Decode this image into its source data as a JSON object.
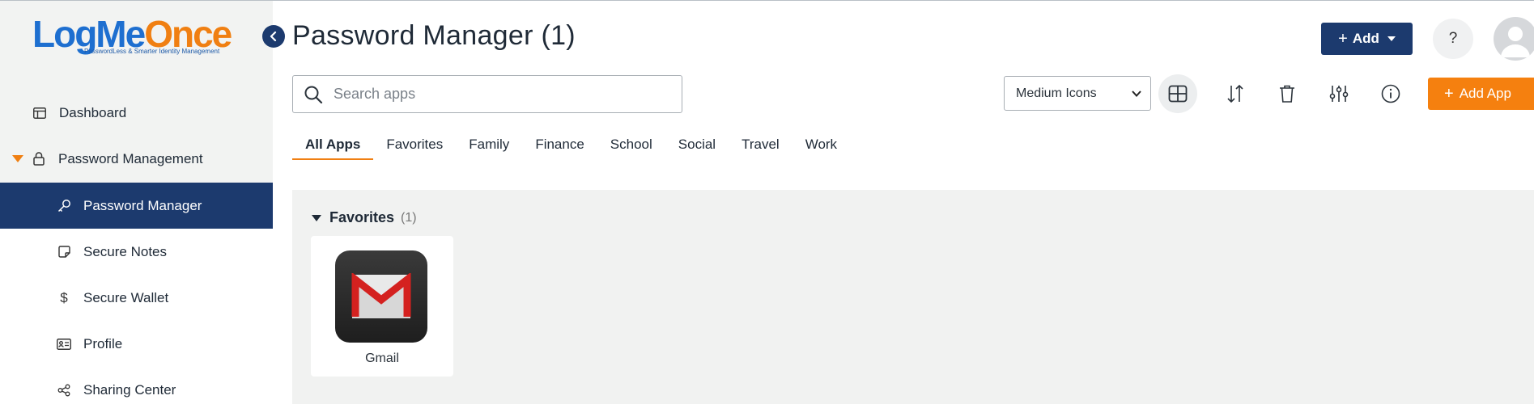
{
  "brand": {
    "logo_part1": "LogMe",
    "logo_part2": "Once",
    "tagline": "PasswordLess & Smarter Identity Management"
  },
  "sidebar": {
    "items": [
      {
        "label": "Dashboard",
        "icon": "dashboard-icon"
      },
      {
        "label": "Password Management",
        "icon": "lock-icon",
        "expanded": true
      },
      {
        "label": "Password Manager",
        "icon": "key-icon",
        "active": true
      },
      {
        "label": "Secure Notes",
        "icon": "note-icon"
      },
      {
        "label": "Secure Wallet",
        "icon": "dollar-icon"
      },
      {
        "label": "Profile",
        "icon": "id-card-icon"
      },
      {
        "label": "Sharing Center",
        "icon": "share-icon"
      }
    ]
  },
  "header": {
    "title": "Password Manager (1)",
    "add_label": "Add",
    "help_label": "?"
  },
  "toolbar": {
    "search_placeholder": "Search apps",
    "view_mode": "Medium Icons",
    "add_app_label": "Add App"
  },
  "tabs": [
    "All Apps",
    "Favorites",
    "Family",
    "Finance",
    "School",
    "Social",
    "Travel",
    "Work"
  ],
  "favorites": {
    "title": "Favorites",
    "count": "(1)",
    "apps": [
      {
        "label": "Gmail"
      }
    ]
  },
  "colors": {
    "navy": "#1c3a6e",
    "orange": "#f5800f",
    "sidebar_bg": "#f2f3f2"
  }
}
